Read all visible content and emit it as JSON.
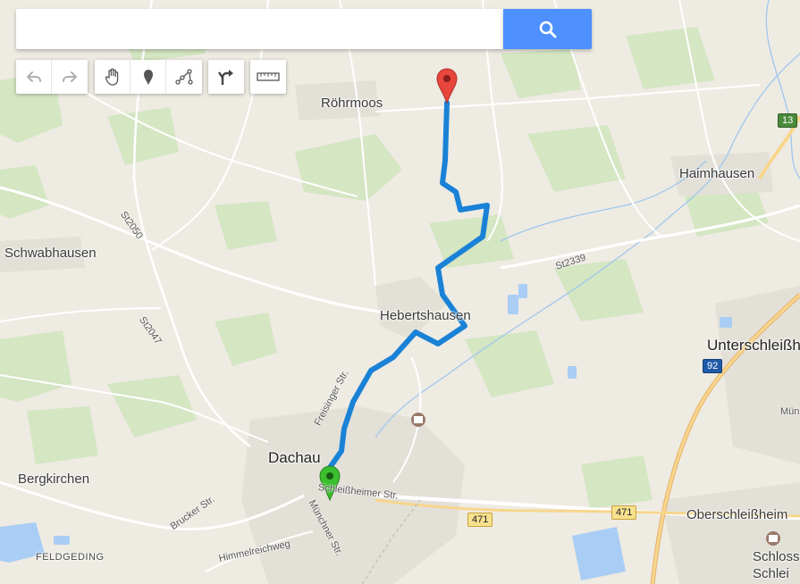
{
  "search": {
    "value": "",
    "placeholder": ""
  },
  "toolbar": {
    "undo_icon": "undo-icon",
    "redo_icon": "redo-icon",
    "pan_icon": "hand-icon",
    "marker_icon": "marker-icon",
    "line_icon": "draw-line-icon",
    "route_icon": "route-icon",
    "measure_icon": "ruler-icon"
  },
  "places": {
    "roehrmoos": "Röhrmoos",
    "haimhausen": "Haimhausen",
    "schwabhausen": "Schwabhausen",
    "hebertshausen": "Hebertshausen",
    "unterschleissheim": "Unterschleißh",
    "dachau": "Dachau",
    "bergkirchen": "Bergkirchen",
    "oberschleissheim": "Oberschleißheim",
    "feldgeding": "FELDGEDING",
    "schloss1": "Schloss",
    "schloss2": "Schlei",
    "muenchen_short": "Mün"
  },
  "roads": {
    "st2050": "St2050",
    "st2047": "St2047",
    "st2339": "St2339",
    "freisinger": "Freisinger Str.",
    "schleissheimer": "Schleißheimer Str.",
    "muenchner": "Münchner Str.",
    "brucker": "Brucker Str.",
    "himmelreich": "Himmelreichweg"
  },
  "shields": {
    "b13": "13",
    "a92": "92",
    "b471a": "471",
    "b471b": "471"
  },
  "markers": {
    "start_color": "#3bbf2e",
    "end_color": "#e8453c",
    "route_color": "#1a82d6"
  }
}
